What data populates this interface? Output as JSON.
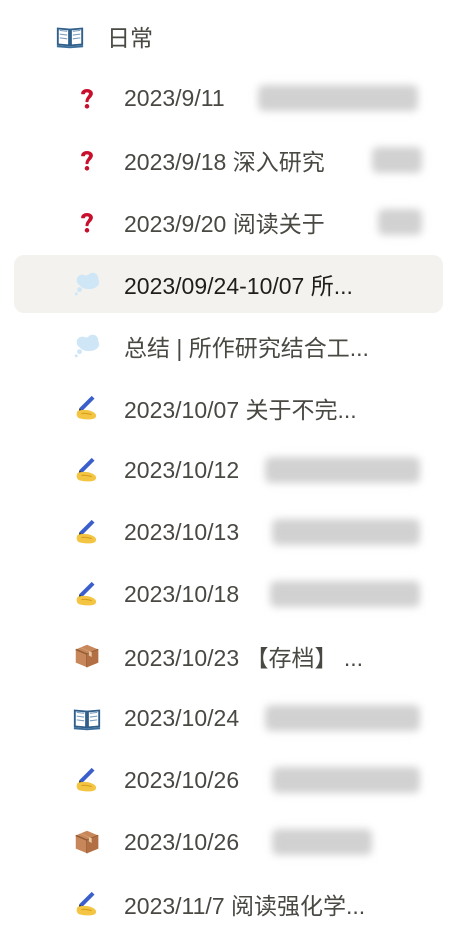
{
  "sidebar": {
    "parent": {
      "icon": "open-book-icon",
      "label": "日常"
    },
    "items": [
      {
        "icon": "question-mark-icon",
        "label": "2023/9/11"
      },
      {
        "icon": "question-mark-icon",
        "label": "2023/9/18 深入研究"
      },
      {
        "icon": "question-mark-icon",
        "label": "2023/9/20 阅读关于"
      },
      {
        "icon": "thought-bubble-icon",
        "label": "2023/09/24-10/07 所...",
        "selected": true
      },
      {
        "icon": "thought-bubble-icon",
        "label": "总结 | 所作研究结合工..."
      },
      {
        "icon": "writing-hand-icon",
        "label": "2023/10/07 关于不完..."
      },
      {
        "icon": "writing-hand-icon",
        "label": "2023/10/12"
      },
      {
        "icon": "writing-hand-icon",
        "label": "2023/10/13"
      },
      {
        "icon": "writing-hand-icon",
        "label": "2023/10/18"
      },
      {
        "icon": "package-icon",
        "label": "2023/10/23 【存档】 ..."
      },
      {
        "icon": "open-book-icon",
        "label": "2023/10/24"
      },
      {
        "icon": "writing-hand-icon",
        "label": "2023/10/26"
      },
      {
        "icon": "package-icon",
        "label": "2023/10/26"
      },
      {
        "icon": "writing-hand-icon",
        "label": "2023/11/7 阅读强化学..."
      }
    ],
    "colors": {
      "selected_bg": "#f3f2ef",
      "text": "#4a4843",
      "question_red": "#c8102e"
    }
  }
}
